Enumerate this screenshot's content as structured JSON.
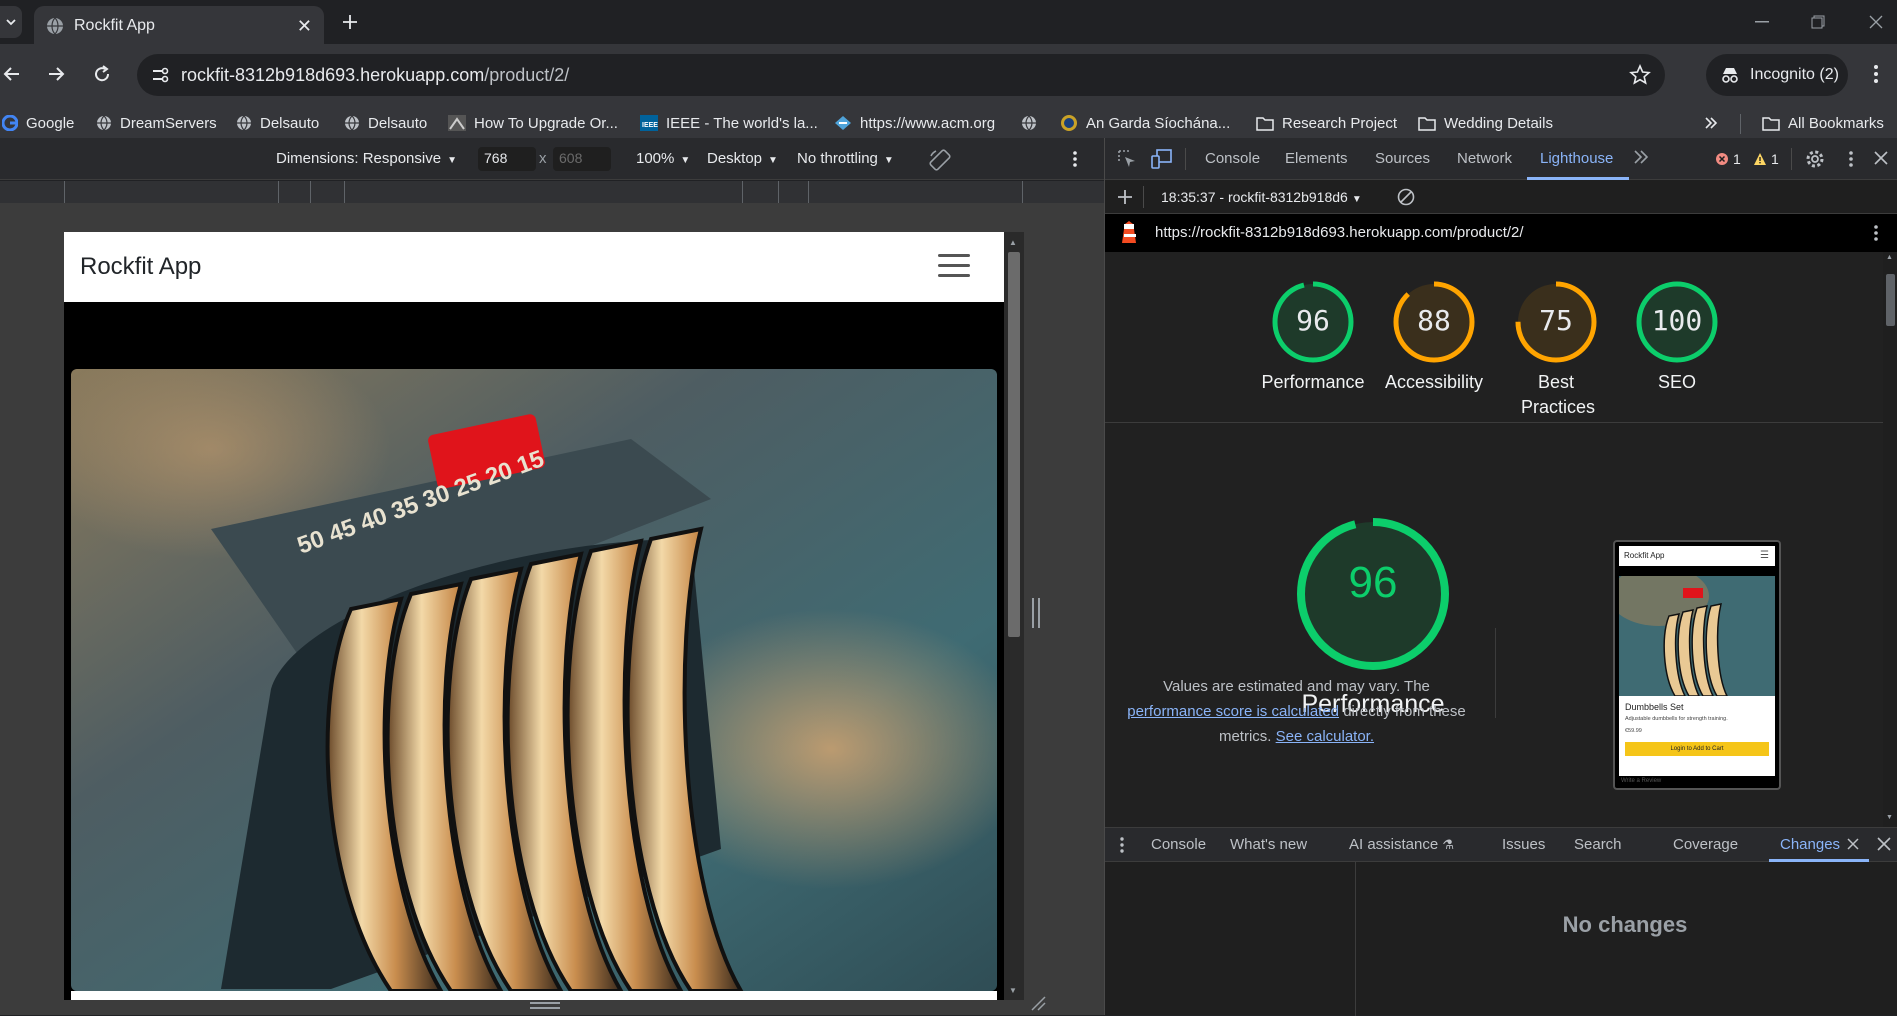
{
  "browser": {
    "tab_title": "Rockfit App",
    "url_host": "rockfit-8312b918d693.herokuapp.com",
    "url_path": "/product/2/",
    "incognito_label": "Incognito (2)",
    "bookmarks": [
      {
        "label": "Google",
        "icon": "google-icon"
      },
      {
        "label": "DreamServers",
        "icon": "globe-icon"
      },
      {
        "label": "Delsauto",
        "icon": "globe-icon"
      },
      {
        "label": "Delsauto",
        "icon": "globe-icon"
      },
      {
        "label": "How To Upgrade Or...",
        "icon": "site-icon"
      },
      {
        "label": "IEEE - The world's la...",
        "icon": "ieee-icon"
      },
      {
        "label": "https://www.acm.org",
        "icon": "acm-icon"
      },
      {
        "label": "",
        "icon": "globe-icon"
      },
      {
        "label": "An Garda Síochána...",
        "icon": "garda-icon"
      },
      {
        "label": "Research Project",
        "icon": "folder-icon"
      },
      {
        "label": "Wedding Details",
        "icon": "folder-icon"
      }
    ],
    "all_bookmarks": "All Bookmarks"
  },
  "device_toolbar": {
    "dimensions": "Dimensions: Responsive",
    "width": "768",
    "times": "x",
    "height": "608",
    "zoom": "100%",
    "device_type": "Desktop",
    "throttling": "No throttling"
  },
  "site": {
    "brand": "Rockfit App"
  },
  "devtools": {
    "tabs": [
      "Console",
      "Elements",
      "Sources",
      "Network",
      "Lighthouse"
    ],
    "active_tab": "Lighthouse",
    "errors": "1",
    "warnings": "1",
    "report_select": "18:35:37 - rockfit-8312b918d6",
    "report_url": "https://rockfit-8312b918d693.herokuapp.com/product/2/",
    "scores": [
      {
        "value": "96",
        "label": "Performance",
        "fraction": 0.96,
        "color": "#0cce6b"
      },
      {
        "value": "88",
        "label": "Accessibility",
        "fraction": 0.88,
        "color": "#ffa400"
      },
      {
        "value": "75",
        "label": "Best Practices",
        "fraction": 0.75,
        "color": "#ffa400"
      },
      {
        "value": "100",
        "label": "SEO",
        "fraction": 1.0,
        "color": "#0cce6b"
      }
    ],
    "big_score": "96",
    "big_title": "Performance",
    "desc_1": "Values are estimated and may vary. The",
    "desc_link": "performance score is calculated",
    "desc_2": "directly from these",
    "desc_3": "metrics.",
    "desc_link2": "See calculator.",
    "thumb": {
      "brand": "Rockfit App",
      "product": "Dumbbells Set",
      "desc": "Adjustable dumbbells for strength training.",
      "price": "€59.99",
      "button": "Login to Add to Cart",
      "review": "Write a Review"
    },
    "drawer_tabs": [
      "Console",
      "What's new",
      "AI assistance",
      "Issues",
      "Search",
      "Coverage",
      "Changes"
    ],
    "drawer_active": "Changes",
    "no_changes": "No changes"
  }
}
